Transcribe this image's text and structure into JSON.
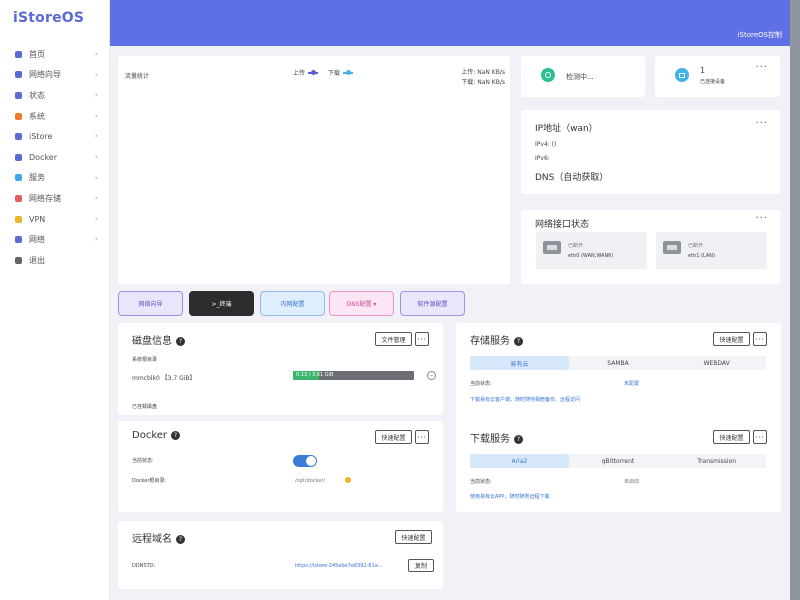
{
  "app": {
    "logo": "iStoreOS",
    "brand": "iStoreOS控制"
  },
  "sidebar": {
    "items": [
      {
        "label": "首页",
        "icon": "home-icon",
        "color": "#5b6bd6"
      },
      {
        "label": "网络向导",
        "icon": "wizard-icon",
        "color": "#5b6bd6"
      },
      {
        "label": "状态",
        "icon": "status-grid-icon",
        "color": "#5b6bd6"
      },
      {
        "label": "系统",
        "icon": "system-icon",
        "color": "#f07a2a"
      },
      {
        "label": "iStore",
        "icon": "istore-icon",
        "color": "#5b6bd6"
      },
      {
        "label": "Docker",
        "icon": "docker-icon",
        "color": "#5b6bd6"
      },
      {
        "label": "服务",
        "icon": "service-icon",
        "color": "#3fa8e8"
      },
      {
        "label": "网络存储",
        "icon": "storage-icon",
        "color": "#e35d5d"
      },
      {
        "label": "VPN",
        "icon": "vpn-icon",
        "color": "#e8b72a"
      },
      {
        "label": "网络",
        "icon": "network-icon",
        "color": "#5b6bd6"
      },
      {
        "label": "退出",
        "icon": "logout-icon",
        "color": "#666666"
      }
    ]
  },
  "traffic": {
    "title": "流量统计",
    "legend_up": "上传",
    "legend_down": "下载",
    "up_color": "#5a5fd6",
    "down_color": "#4ab2e6",
    "up_rate": "上传: NaN KB/s",
    "down_rate": "下载: NaN KB/s"
  },
  "status_cards": {
    "network": {
      "text": "检测中..."
    },
    "devices": {
      "count": "1",
      "label": "已连接设备"
    }
  },
  "ip_card": {
    "title": "IP地址（wan）",
    "ipv4": "IPv4:  ()",
    "ipv6": "IPv6:",
    "dns": "DNS（自动获取）"
  },
  "ports": {
    "title": "网络接口状态",
    "items": [
      {
        "status": "已断开",
        "name": "eth0 (WAN,WAN6)"
      },
      {
        "status": "已断开",
        "name": "eth1 (LAN)"
      }
    ]
  },
  "quick_buttons": [
    {
      "label": "网络向导"
    },
    {
      "label": ">_终端"
    },
    {
      "label": "内网配置"
    },
    {
      "label": "DNS配置 ▾"
    },
    {
      "label": "软件源配置"
    }
  ],
  "disk": {
    "title": "磁盘信息",
    "manage_btn": "文件管理",
    "system_root_label": "系统根目录",
    "device": "mmcblk0 【3.7 GiB】",
    "usage_text": "0.13 / 3.61 GiB",
    "usage_fraction": 0.04,
    "mounted_label": "已挂载磁盘"
  },
  "storage": {
    "title": "存储服务",
    "config_btn": "快速配置",
    "tabs": [
      "易有云",
      "SAMBA",
      "WEBDAV"
    ],
    "status_label": "当前状态:",
    "status_value": "未配置",
    "hint": "下载易有云客户端，随时随地相册备份、远程访问"
  },
  "docker": {
    "title": "Docker",
    "config_btn": "快速配置",
    "status_label": "当前状态:",
    "root_label": "Docker根目录:",
    "root_value": "/opt/docker/"
  },
  "download": {
    "title": "下载服务",
    "config_btn": "快速配置",
    "tabs": [
      "Aria2",
      "qBittorrent",
      "Transmission"
    ],
    "status_label": "当前状态:",
    "status_value": "未启动",
    "hint": "使用易有云APP，随时随地远程下载"
  },
  "remote": {
    "title": "远程域名",
    "config_btn": "快速配置",
    "ddns_label": "DDNSTO:",
    "ddns_value": "https://istore-245ebe7e8392-81a...",
    "copy_btn": "复制"
  }
}
